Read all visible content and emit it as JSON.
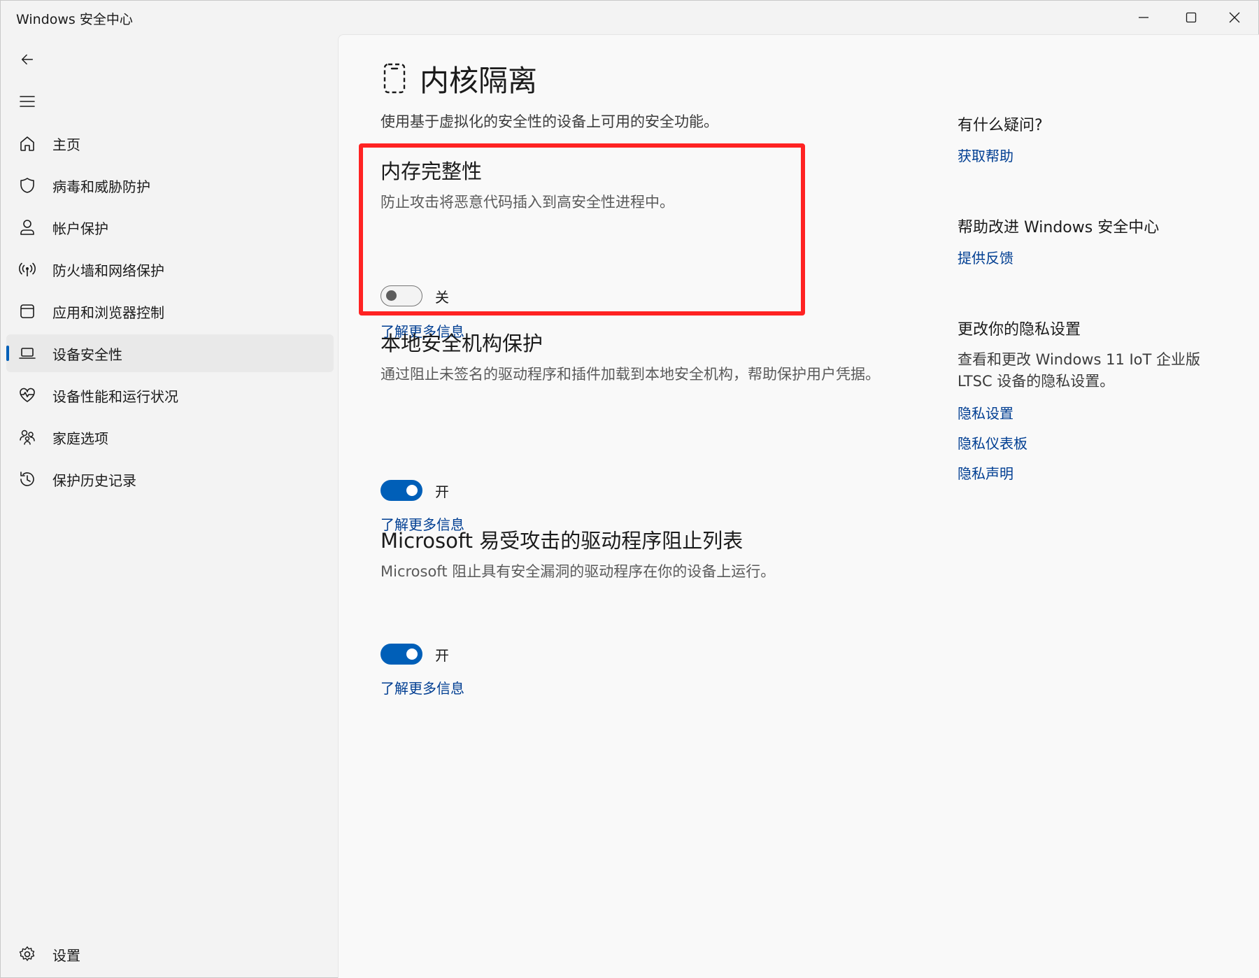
{
  "window": {
    "title": "Windows 安全中心"
  },
  "sidebar": {
    "items": [
      {
        "label": "主页",
        "icon": "home-icon"
      },
      {
        "label": "病毒和威胁防护",
        "icon": "shield-icon"
      },
      {
        "label": "帐户保护",
        "icon": "person-icon"
      },
      {
        "label": "防火墙和网络保护",
        "icon": "wifi-signal-icon"
      },
      {
        "label": "应用和浏览器控制",
        "icon": "app-window-icon"
      },
      {
        "label": "设备安全性",
        "icon": "laptop-icon",
        "selected": true
      },
      {
        "label": "设备性能和运行状况",
        "icon": "heart-pulse-icon"
      },
      {
        "label": "家庭选项",
        "icon": "family-icon"
      },
      {
        "label": "保护历史记录",
        "icon": "history-icon"
      }
    ],
    "settings_label": "设置"
  },
  "main": {
    "title": "内核隔离",
    "subtitle": "使用基于虚拟化的安全性的设备上可用的安全功能。",
    "sections": [
      {
        "title": "内存完整性",
        "description": "防止攻击将恶意代码插入到高安全性进程中。",
        "toggle_on": false,
        "toggle_label": "关",
        "link": "了解更多信息"
      },
      {
        "title": "本地安全机构保护",
        "description": "通过阻止未签名的驱动程序和插件加载到本地安全机构，帮助保护用户凭据。",
        "toggle_on": true,
        "toggle_label": "开",
        "link": "了解更多信息"
      },
      {
        "title": "Microsoft 易受攻击的驱动程序阻止列表",
        "description": "Microsoft 阻止具有安全漏洞的驱动程序在你的设备上运行。",
        "toggle_on": true,
        "toggle_label": "开",
        "link": "了解更多信息"
      }
    ]
  },
  "aside": {
    "help_title": "有什么疑问?",
    "help_link": "获取帮助",
    "improve_title": "帮助改进 Windows 安全中心",
    "improve_link": "提供反馈",
    "privacy_title": "更改你的隐私设置",
    "privacy_text": "查看和更改 Windows 11 IoT 企业版 LTSC 设备的隐私设置。",
    "privacy_links": [
      "隐私设置",
      "隐私仪表板",
      "隐私声明"
    ]
  },
  "colors": {
    "accent": "#005fb8",
    "link": "#003e92",
    "highlight": "#ff2323"
  }
}
